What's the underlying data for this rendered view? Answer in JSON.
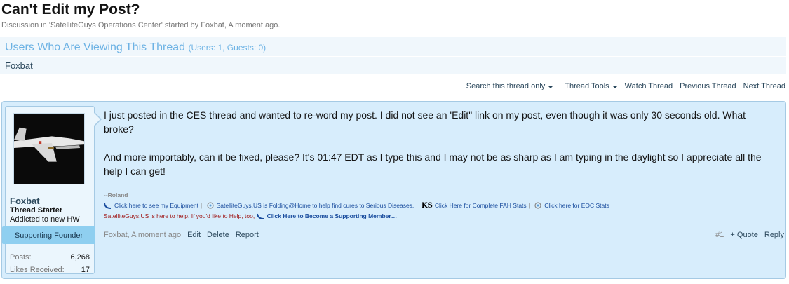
{
  "thread": {
    "title": "Can't Edit my Post?",
    "desc_prefix": "Discussion in '",
    "forum": "SatelliteGuys Operations Center",
    "desc_mid": "' started by ",
    "author": "Foxbat",
    "desc_suffix": ", A moment ago."
  },
  "viewers": {
    "title": "Users Who Are Viewing This Thread",
    "counts": "(Users: 1, Guests: 0)",
    "names": "Foxbat"
  },
  "toolbar": {
    "search": "Search this thread only",
    "tools": "Thread Tools",
    "watch": "Watch Thread",
    "prev": "Previous Thread",
    "next": "Next Thread"
  },
  "post": {
    "user": {
      "name": "Foxbat",
      "title": "Thread Starter",
      "custom_title": "Addicted to new HW",
      "banner": "Supporting Founder",
      "posts_label": "Posts:",
      "posts_value": "6,268",
      "likes_label": "Likes Received:",
      "likes_value": "17"
    },
    "message": [
      "I just posted in the CES thread and wanted to re-word my post. I did not see an 'Edit\" link on my post, even though it was only 30 seconds old. What broke?",
      "And more importably, can it be fixed, please? It's 01:47 EDT as I type this and I may not be as sharp as I am typing in the daylight so I appreciate all the help I can get!"
    ],
    "signature": {
      "name": "--Roland",
      "link1": "Click here to see my Equipment",
      "link2": "SatelliteGuys.US is Folding@Home to help find cures to Serious Diseases.",
      "ks": "KS",
      "link3": "Click Here for Complete FAH Stats",
      "link4": "Click here for EOC Stats",
      "help_text": "SatelliteGuys.US is here to help. If you'd like to Help, too,",
      "link5": "Click Here to Become a Supporting Member…",
      "sep": "|"
    },
    "footer": {
      "date": "Foxbat, A moment ago",
      "edit": "Edit",
      "delete": "Delete",
      "report": "Report",
      "number": "#1",
      "quote": "+ Quote",
      "reply": "Reply"
    }
  }
}
